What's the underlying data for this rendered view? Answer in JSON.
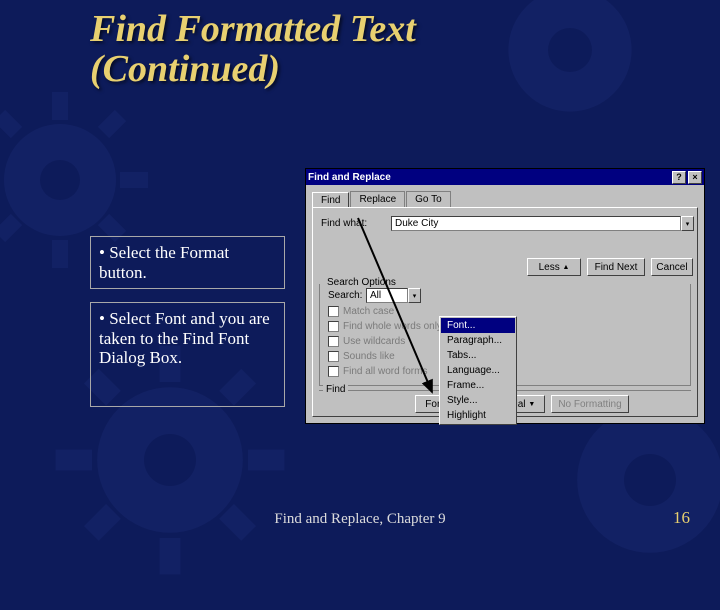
{
  "slide": {
    "title_line1": "Find Formatted Text",
    "title_line2": "(Continued)",
    "bullet1": "• Select the Format button.",
    "bullet2": "• Select Font and you are taken to the Find Font Dialog Box.",
    "footer_center": "Find and Replace, Chapter 9",
    "footer_page": "16"
  },
  "dialog": {
    "title": "Find and Replace",
    "tabs": {
      "find": "Find",
      "replace": "Replace",
      "goto": "Go To"
    },
    "find_what_label": "Find what:",
    "find_what_value": "Duke City",
    "buttons": {
      "less": "Less",
      "find_next": "Find Next",
      "cancel": "Cancel"
    },
    "options": {
      "heading": "Search Options",
      "search_label": "Search:",
      "search_value": "All",
      "match_case": "Match case",
      "whole_word": "Find whole words only",
      "wildcards": "Use wildcards",
      "sounds_like": "Sounds like",
      "word_forms": "Find all word forms"
    },
    "find_section": {
      "heading": "Find",
      "format": "Format",
      "special": "Special",
      "no_formatting": "No Formatting"
    },
    "format_menu": {
      "font": "Font...",
      "paragraph": "Paragraph...",
      "tabs": "Tabs...",
      "language": "Language...",
      "frame": "Frame...",
      "style": "Style...",
      "highlight": "Highlight"
    }
  }
}
